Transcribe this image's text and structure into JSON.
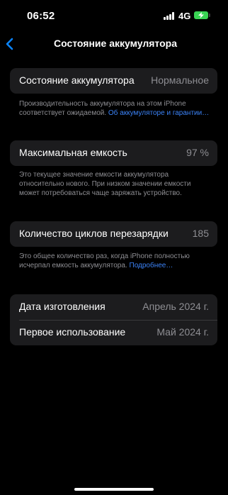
{
  "status_bar": {
    "time": "06:52",
    "network": "4G",
    "battery_level": 0.95,
    "battery_charging": true
  },
  "nav": {
    "back_icon": "chevron-left-icon",
    "title": "Состояние аккумулятора"
  },
  "battery_health": {
    "label": "Состояние аккумулятора",
    "value": "Нормальное",
    "note_text": "Производительность аккумулятора на этом iPhone соответствует ожидаемой. ",
    "note_link": "Об аккумуляторе и гарантии…"
  },
  "max_capacity": {
    "label": "Максимальная емкость",
    "value": "97 %",
    "note": "Это текущее значение емкости аккумулятора относительно нового. При низком значении емкости может потребоваться чаще заряжать устройство."
  },
  "cycle_count": {
    "label": "Количество циклов перезарядки",
    "value": "185",
    "note_text": "Это общее количество раз, когда iPhone полностью исчерпал емкость аккумулятора. ",
    "note_link": "Подробнее…"
  },
  "dates": [
    {
      "label": "Дата изготовления",
      "value": "Апрель 2024 г."
    },
    {
      "label": "Первое использование",
      "value": "Май 2024 г."
    }
  ],
  "colors": {
    "background": "#000000",
    "card": "#1c1c1e",
    "secondary_text": "#8e8e93",
    "link": "#3b82f6",
    "accent": "#0a84ff",
    "battery": "#39d353"
  }
}
